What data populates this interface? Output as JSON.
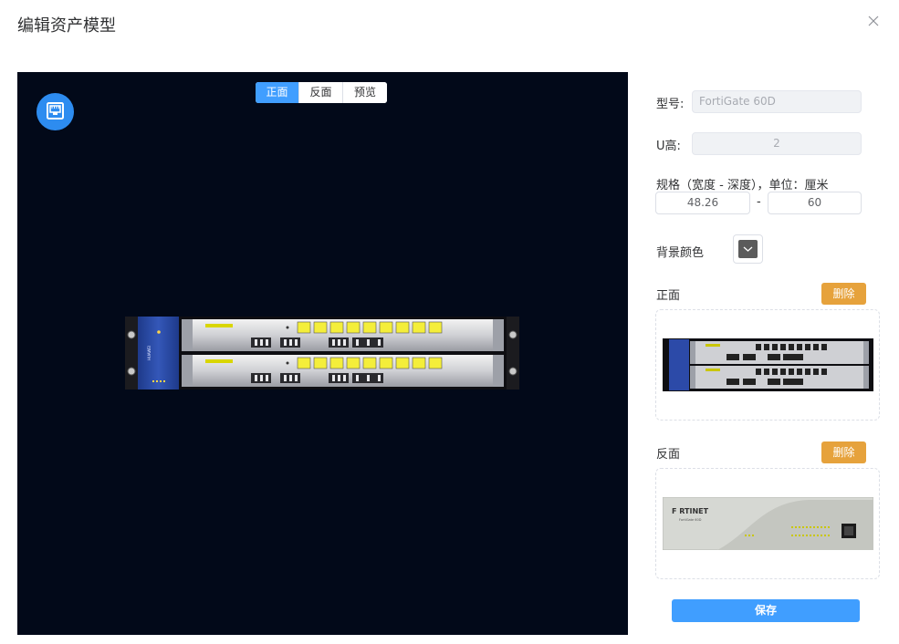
{
  "dialog": {
    "title": "编辑资产模型"
  },
  "stage": {
    "tabs": [
      {
        "label": "正面",
        "active": true
      },
      {
        "label": "反面",
        "active": false
      },
      {
        "label": "预览",
        "active": false
      }
    ],
    "background_color": "#020919",
    "icon": "network-port-icon"
  },
  "form": {
    "model_label": "型号:",
    "model_value": "FortiGate 60D",
    "u_label": "U高:",
    "u_value": "2",
    "spec_label": "规格（宽度 - 深度），单位：厘米",
    "width_value": "48.26",
    "dash": "-",
    "depth_value": "60",
    "bg_color_label": "背景颜色",
    "bg_color": "#5b5b5b",
    "front_label": "正面",
    "back_label": "反面",
    "delete_label": "删除",
    "save_label": "保存"
  },
  "devices": {
    "front_vendor": "HUAWEI",
    "back_brand": "F RTINET",
    "back_model": "FortiGate 60D"
  },
  "colors": {
    "primary": "#409eff",
    "warning": "#e6a23c"
  }
}
